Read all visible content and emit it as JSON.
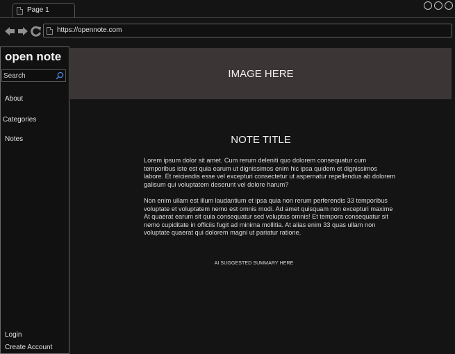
{
  "browser": {
    "tab_title": "Page 1",
    "url": "https://opennote.com",
    "icons": [
      "page-icon",
      "back-arrow-icon",
      "forward-arrow-icon",
      "reload-icon",
      "window-control-icon"
    ]
  },
  "sidebar": {
    "brand": "open note",
    "search_placeholder": "Search",
    "nav": {
      "about": "About",
      "categories": "Categories",
      "notes": "Notes"
    },
    "account": {
      "login": "Login",
      "create_account": "Create Account"
    }
  },
  "main": {
    "image_placeholder": "IMAGE HERE",
    "note_title": "NOTE TITLE",
    "paragraphs": [
      "Lorem ipsum dolor sit amet. Cum rerum deleniti quo dolorem consequatur cum temporibus iste est quia earum ut dignissimos enim hic ipsa quidem et dignissimos labore. Et reiciendis esse vel excepturi consectetur ut aspernatur repellendus ab dolorem galisum qui voluptatem deserunt vel dolore harum?",
      "Non enim ullam est illum laudantium et ipsa quia non rerum perferendis 33 temporibus voluptate et voluptatem nemo est omnis modi. Ad amet quisquam non excepturi maxime At quaerat earum sit quia consequatur sed voluptas omnis! Et tempora consequatur sit nemo cupiditate in officiis fugit ad minima mollitia. At alias enim 33 quas ullam non voluptate quaerat qui dolorem magni ut pariatur ratione."
    ],
    "ai_summary": "AI SUGGESTED SUMMARY HERE"
  },
  "colors": {
    "background": "#141414",
    "hero_fill": "#3b3535",
    "search_icon": "#4a7fd4"
  }
}
